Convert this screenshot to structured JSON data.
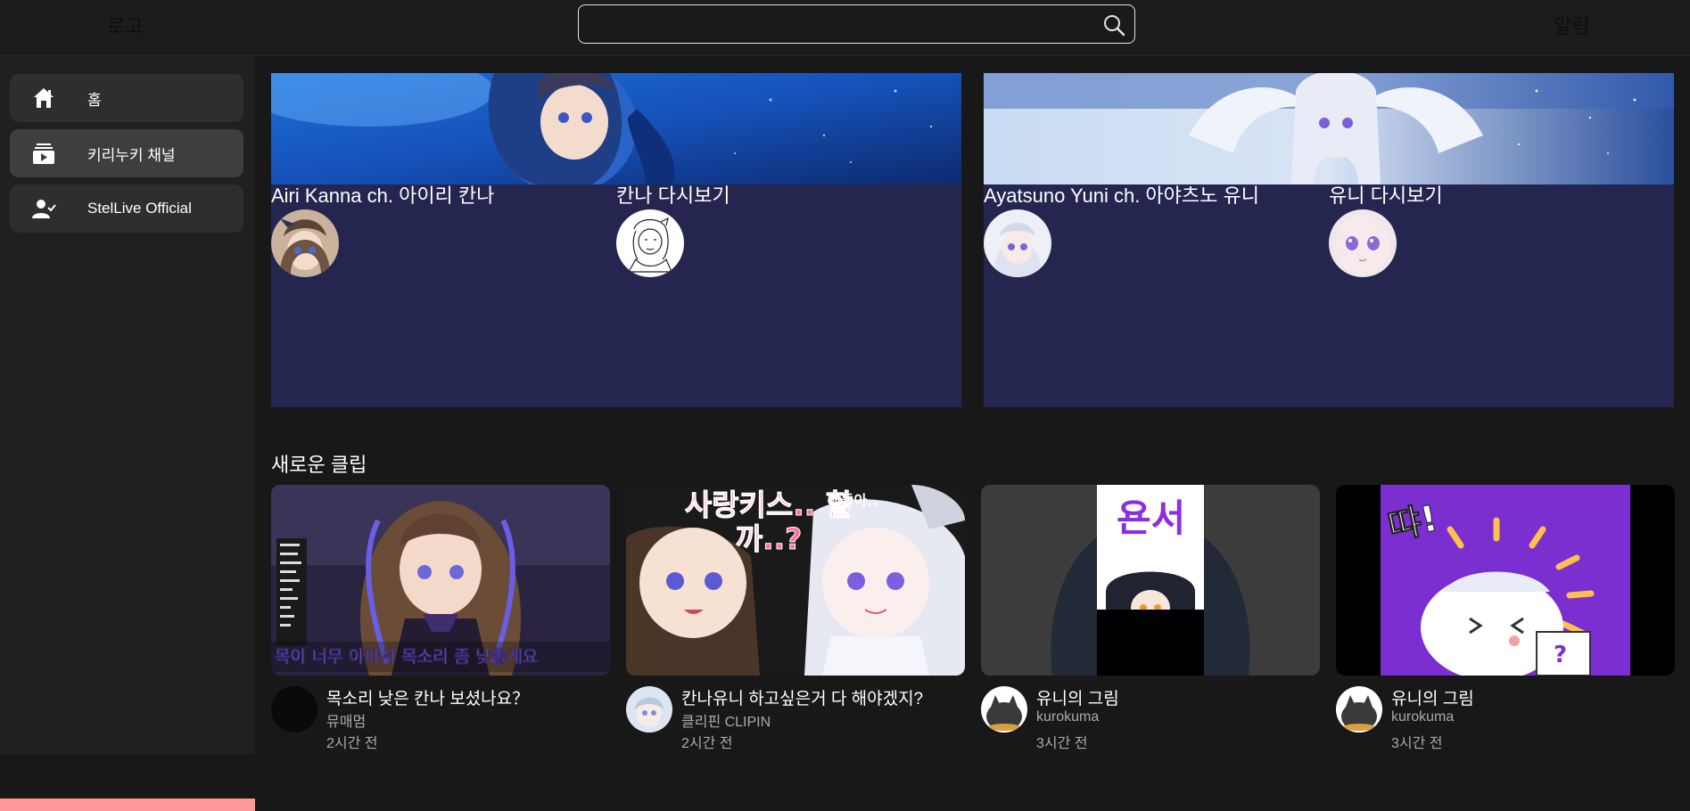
{
  "header": {
    "logo": "로고",
    "search_placeholder": "",
    "notifications": "알림"
  },
  "sidebar": {
    "items": [
      {
        "label": "홈",
        "icon": "home-icon"
      },
      {
        "label": "키리누키 채널",
        "icon": "video-library-icon",
        "active": true
      },
      {
        "label": "StelLive Official",
        "icon": "user-check-icon"
      }
    ]
  },
  "channels": [
    {
      "left_title": "Airi Kanna ch. 아이리 칸나",
      "right_title": "칸나 다시보기"
    },
    {
      "left_title": "Ayatsuno Yuni ch. 아야츠노 유니",
      "right_title": "유니 다시보기"
    }
  ],
  "section": {
    "new_clips": "새로운 클립"
  },
  "clips": [
    {
      "title": "목소리 낮은 칸나 보셨나요？",
      "channel": "뮤매멈",
      "time": "2시간 전",
      "overlay": "목이 너무 아파서 목소리 좀 낮출게요"
    },
    {
      "title": "칸나유니 하고싶은거 다 해야겠지?",
      "channel": "클리핀 CLIPIN",
      "time": "2시간 전",
      "overlay": "사랑키스.. 할까..?",
      "overlay2": "애들아.."
    },
    {
      "title": "유니의 그림",
      "channel": "kurokuma",
      "time": "3시간 전",
      "overlay": "욘서"
    },
    {
      "title": "유니의 그림",
      "channel": "kurokuma",
      "time": "3시간 전",
      "overlay": "땨!",
      "overlay2": "?"
    }
  ],
  "colors": {
    "card_bg": "#242650",
    "accent_bottom": "#ff9898"
  }
}
